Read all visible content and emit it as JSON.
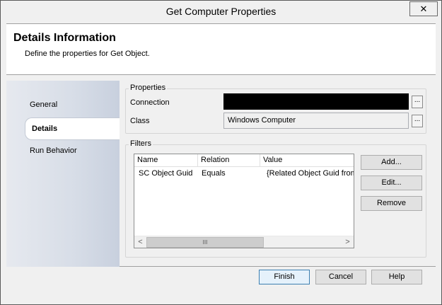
{
  "window": {
    "title": "Get Computer Properties",
    "close_glyph": "✕"
  },
  "header": {
    "title": "Details Information",
    "subtitle": "Define the properties for Get Object."
  },
  "nav": {
    "items": [
      {
        "label": "General"
      },
      {
        "label": "Details",
        "selected": true
      },
      {
        "label": "Run Behavior"
      }
    ]
  },
  "properties": {
    "legend": "Properties",
    "connection_label": "Connection",
    "connection_value": "",
    "class_label": "Class",
    "class_value": "Windows Computer",
    "browse_label": "..."
  },
  "filters": {
    "legend": "Filters",
    "columns": [
      "Name",
      "Relation",
      "Value"
    ],
    "rows": [
      {
        "name": "SC Object Guid",
        "relation": "Equals",
        "value": "{Related Object Guid from"
      }
    ],
    "scroll_left": "<",
    "scroll_right": ">",
    "scroll_grip": "III",
    "add_label": "Add...",
    "edit_label": "Edit...",
    "remove_label": "Remove"
  },
  "footer": {
    "finish_label": "Finish",
    "cancel_label": "Cancel",
    "help_label": "Help"
  },
  "colors": {
    "nav_gradient_end": "#c8d0de",
    "default_button_border": "#3c7fb1",
    "connection_field": "#000000"
  },
  "icons": {
    "close": "close-icon",
    "scroll_left": "chevron-left-icon",
    "scroll_right": "chevron-right-icon"
  }
}
